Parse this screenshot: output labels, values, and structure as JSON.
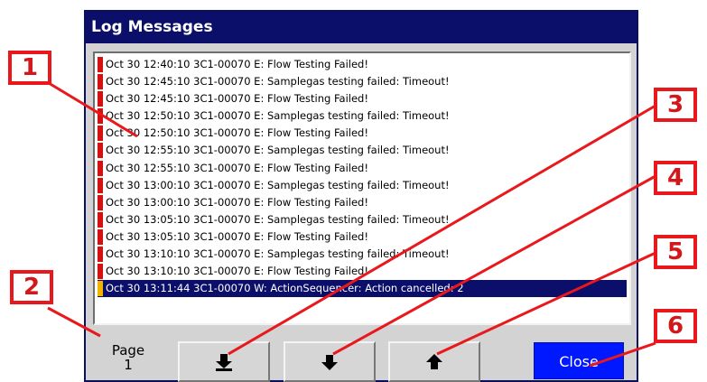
{
  "dialog": {
    "title": "Log Messages"
  },
  "log": {
    "entries": [
      {
        "text": "Oct 30 12:40:10 3C1-00070 E: Flow Testing Failed!",
        "severity_color": "#d41010"
      },
      {
        "text": "Oct 30 12:45:10 3C1-00070 E: Samplegas testing failed: Timeout!",
        "severity_color": "#d41010"
      },
      {
        "text": "Oct 30 12:45:10 3C1-00070 E: Flow Testing Failed!",
        "severity_color": "#d41010"
      },
      {
        "text": "Oct 30 12:50:10 3C1-00070 E: Samplegas testing failed: Timeout!",
        "severity_color": "#d41010"
      },
      {
        "text": "Oct 30 12:50:10 3C1-00070 E: Flow Testing Failed!",
        "severity_color": "#d41010"
      },
      {
        "text": "Oct 30 12:55:10 3C1-00070 E: Samplegas testing failed: Timeout!",
        "severity_color": "#d41010"
      },
      {
        "text": "Oct 30 12:55:10 3C1-00070 E: Flow Testing Failed!",
        "severity_color": "#d41010"
      },
      {
        "text": "Oct 30 13:00:10 3C1-00070 E: Samplegas testing failed: Timeout!",
        "severity_color": "#d41010"
      },
      {
        "text": "Oct 30 13:00:10 3C1-00070 E: Flow Testing Failed!",
        "severity_color": "#d41010"
      },
      {
        "text": "Oct 30 13:05:10 3C1-00070 E: Samplegas testing failed: Timeout!",
        "severity_color": "#d41010"
      },
      {
        "text": "Oct 30 13:05:10 3C1-00070 E: Flow Testing Failed!",
        "severity_color": "#d41010"
      },
      {
        "text": "Oct 30 13:10:10 3C1-00070 E: Samplegas testing failed: Timeout!",
        "severity_color": "#d41010"
      },
      {
        "text": "Oct 30 13:10:10 3C1-00070 E: Flow Testing Failed!",
        "severity_color": "#d41010"
      },
      {
        "text": "Oct 30 13:11:44 3C1-00070 W: ActionSequencer: Action cancelled: 2",
        "severity_color": "#f2b400",
        "selected": true
      }
    ]
  },
  "pager": {
    "label": "Page",
    "number": "1"
  },
  "buttons": {
    "last_page_icon": "arrow-down-to-bar-icon",
    "next_page_icon": "arrow-down-icon",
    "prev_page_icon": "arrow-up-icon",
    "close_label": "Close"
  },
  "callouts": [
    "1",
    "2",
    "3",
    "4",
    "5",
    "6"
  ],
  "colors": {
    "title_bar": "#0b0f6a",
    "selected_row": "#0b0f6a",
    "error_marker": "#d41010",
    "warning_marker": "#f2b400",
    "close_button": "#0018ff",
    "callout": "#e8181c"
  }
}
